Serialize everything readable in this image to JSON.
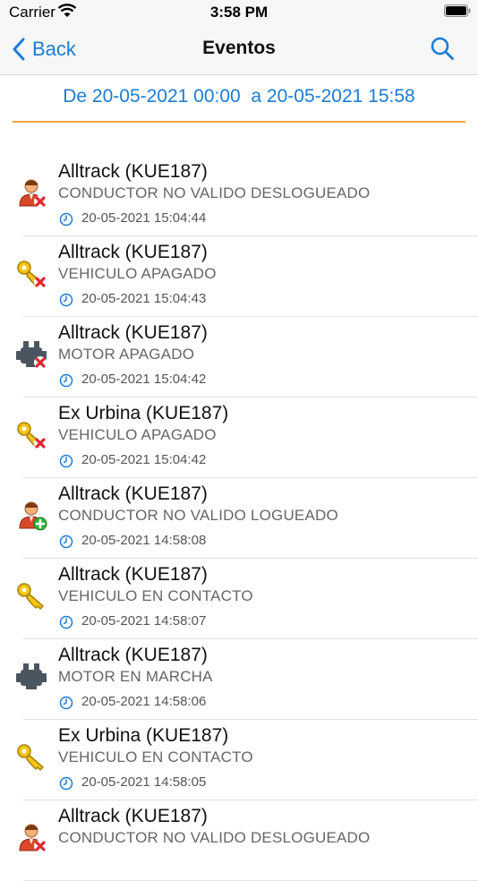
{
  "status_bar": {
    "carrier": "Carrier",
    "time": "3:58 PM"
  },
  "nav": {
    "back_label": "Back",
    "title": "Eventos"
  },
  "date_range": "De 20-05-2021 00:00  a 20-05-2021 15:58",
  "colors": {
    "accent": "#1a7cd6",
    "divider": "#f0a43a"
  },
  "events": [
    {
      "title": "Alltrack (KUE187)",
      "event": "CONDUCTOR NO VALIDO DESLOGUEADO",
      "timestamp": "20-05-2021 15:04:44",
      "icon": "driver-remove-icon"
    },
    {
      "title": "Alltrack (KUE187)",
      "event": "VEHICULO APAGADO",
      "timestamp": "20-05-2021 15:04:43",
      "icon": "key-off-icon"
    },
    {
      "title": "Alltrack (KUE187)",
      "event": "MOTOR APAGADO",
      "timestamp": "20-05-2021 15:04:42",
      "icon": "engine-off-icon"
    },
    {
      "title": "Ex Urbina (KUE187)",
      "event": "VEHICULO APAGADO",
      "timestamp": "20-05-2021 15:04:42",
      "icon": "key-off-icon"
    },
    {
      "title": "Alltrack (KUE187)",
      "event": "CONDUCTOR NO VALIDO LOGUEADO",
      "timestamp": "20-05-2021 14:58:08",
      "icon": "driver-add-icon"
    },
    {
      "title": "Alltrack (KUE187)",
      "event": "VEHICULO EN CONTACTO",
      "timestamp": "20-05-2021 14:58:07",
      "icon": "key-icon"
    },
    {
      "title": "Alltrack (KUE187)",
      "event": "MOTOR EN MARCHA",
      "timestamp": "20-05-2021 14:58:06",
      "icon": "engine-icon"
    },
    {
      "title": "Ex Urbina (KUE187)",
      "event": "VEHICULO EN CONTACTO",
      "timestamp": "20-05-2021 14:58:05",
      "icon": "key-icon"
    },
    {
      "title": "Alltrack (KUE187)",
      "event": "CONDUCTOR NO VALIDO DESLOGUEADO",
      "timestamp": "",
      "icon": "driver-remove-icon"
    }
  ]
}
